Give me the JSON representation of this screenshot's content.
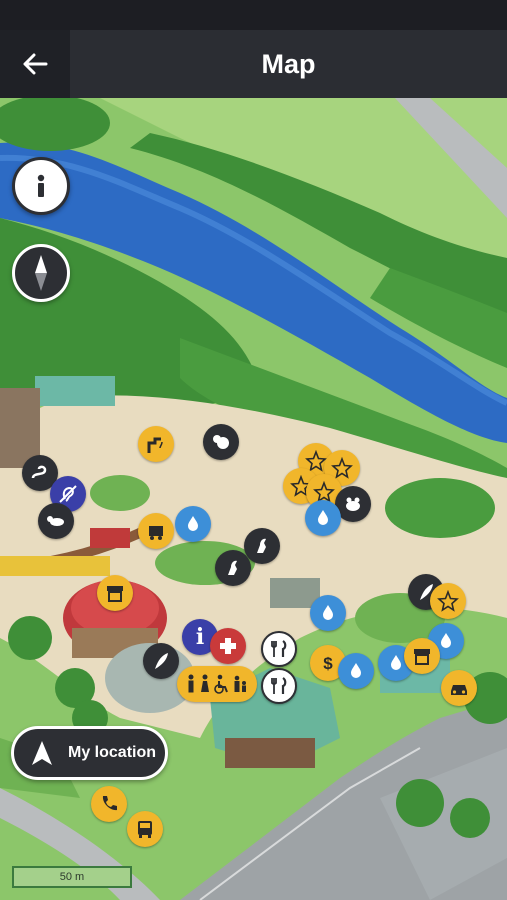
{
  "app": {
    "title": "Map"
  },
  "header": {
    "back_label": "back"
  },
  "controls": {
    "my_location_label": "My location"
  },
  "scale": {
    "label": "50 m"
  },
  "colors": {
    "statusbar": "#1d1e23",
    "appbar": "#2b2d33",
    "poi_yellow": "#f1b62b",
    "poi_blue": "#3d8fd8",
    "poi_dark": "#2d2f34",
    "river": "#2d6bc4",
    "grass": "#8cc66a"
  },
  "pois": [
    {
      "name": "drinking-fountain",
      "icon": "fountain-icon"
    },
    {
      "name": "koala-exhibit",
      "icon": "koala-icon"
    },
    {
      "name": "accessibility-info",
      "icon": "wheelchair-icon"
    },
    {
      "name": "snake-exhibit",
      "icon": "snake-icon"
    },
    {
      "name": "hearing-loop",
      "icon": "hearing-icon"
    },
    {
      "name": "possum-exhibit",
      "icon": "possum-icon"
    },
    {
      "name": "train-station",
      "icon": "train-icon"
    },
    {
      "name": "hand-wash",
      "icon": "handwash-icon"
    },
    {
      "name": "highlight-star-1",
      "icon": "star-icon"
    },
    {
      "name": "highlight-star-2",
      "icon": "star-icon"
    },
    {
      "name": "highlight-star-3",
      "icon": "star-icon"
    },
    {
      "name": "highlight-star-4",
      "icon": "star-icon"
    },
    {
      "name": "frog-exhibit",
      "icon": "frog-icon"
    },
    {
      "name": "hand-wash-2",
      "icon": "handwash-icon"
    },
    {
      "name": "kangaroo-exhibit-1",
      "icon": "kangaroo-icon"
    },
    {
      "name": "kangaroo-exhibit-2",
      "icon": "kangaroo-icon"
    },
    {
      "name": "shop",
      "icon": "shop-icon"
    },
    {
      "name": "feather-bird",
      "icon": "feather-icon"
    },
    {
      "name": "highlight-star-5",
      "icon": "star-icon"
    },
    {
      "name": "hand-wash-3",
      "icon": "handwash-icon"
    },
    {
      "name": "information",
      "icon": "info-icon"
    },
    {
      "name": "first-aid",
      "icon": "first-aid-icon"
    },
    {
      "name": "restaurant-1",
      "icon": "cutlery-icon"
    },
    {
      "name": "restaurant-2",
      "icon": "cutlery-icon"
    },
    {
      "name": "atm",
      "icon": "dollar-icon"
    },
    {
      "name": "hand-wash-4",
      "icon": "handwash-icon"
    },
    {
      "name": "hand-wash-5",
      "icon": "handwash-icon"
    },
    {
      "name": "shop-2",
      "icon": "shop-icon"
    },
    {
      "name": "hand-wash-6",
      "icon": "handwash-icon"
    },
    {
      "name": "taxi",
      "icon": "taxi-icon"
    },
    {
      "name": "toilets",
      "icon": "toilets-icon"
    },
    {
      "name": "bird-exhibit",
      "icon": "feather-icon"
    },
    {
      "name": "phone",
      "icon": "phone-icon"
    },
    {
      "name": "bus",
      "icon": "bus-icon"
    }
  ]
}
